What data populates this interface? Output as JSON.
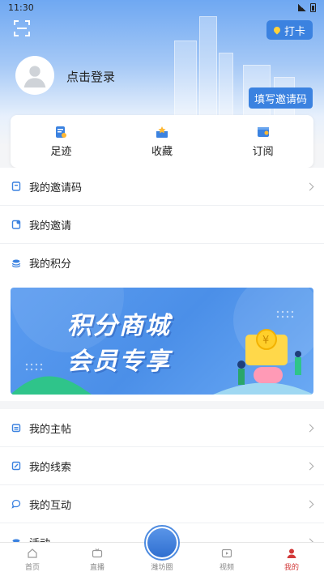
{
  "status_bar": {
    "time": "11:30"
  },
  "header": {
    "checkin_label": "打卡",
    "login_text": "点击登录",
    "invite_code_button": "填写邀请码"
  },
  "quick_actions": [
    {
      "label": "足迹",
      "icon": "footprint-icon"
    },
    {
      "label": "收藏",
      "icon": "favorite-icon"
    },
    {
      "label": "订阅",
      "icon": "subscribe-icon"
    }
  ],
  "menu_top": [
    {
      "label": "我的邀请码",
      "icon": "invite-code-icon",
      "chevron": true
    },
    {
      "label": "我的邀请",
      "icon": "invite-icon",
      "chevron": false
    },
    {
      "label": "我的积分",
      "icon": "points-icon",
      "chevron": false
    }
  ],
  "banner": {
    "line1": "积分商城",
    "line2": "会员专享"
  },
  "menu_bottom": [
    {
      "label": "我的主帖",
      "icon": "post-icon",
      "chevron": true
    },
    {
      "label": "我的线索",
      "icon": "lead-icon",
      "chevron": true
    },
    {
      "label": "我的互动",
      "icon": "interaction-icon",
      "chevron": true
    },
    {
      "label": "活动",
      "icon": "activity-icon",
      "chevron": true
    }
  ],
  "bottom_nav": [
    {
      "label": "首页",
      "icon": "home-icon",
      "active": false
    },
    {
      "label": "直播",
      "icon": "live-icon",
      "active": false
    },
    {
      "label": "潍坊圈",
      "icon": "weifang-circle-icon",
      "active": false
    },
    {
      "label": "视频",
      "icon": "video-icon",
      "active": false
    },
    {
      "label": "我的",
      "icon": "profile-icon",
      "active": true
    }
  ],
  "colors": {
    "accent": "#3b82e0",
    "active_nav": "#d23a3a"
  }
}
